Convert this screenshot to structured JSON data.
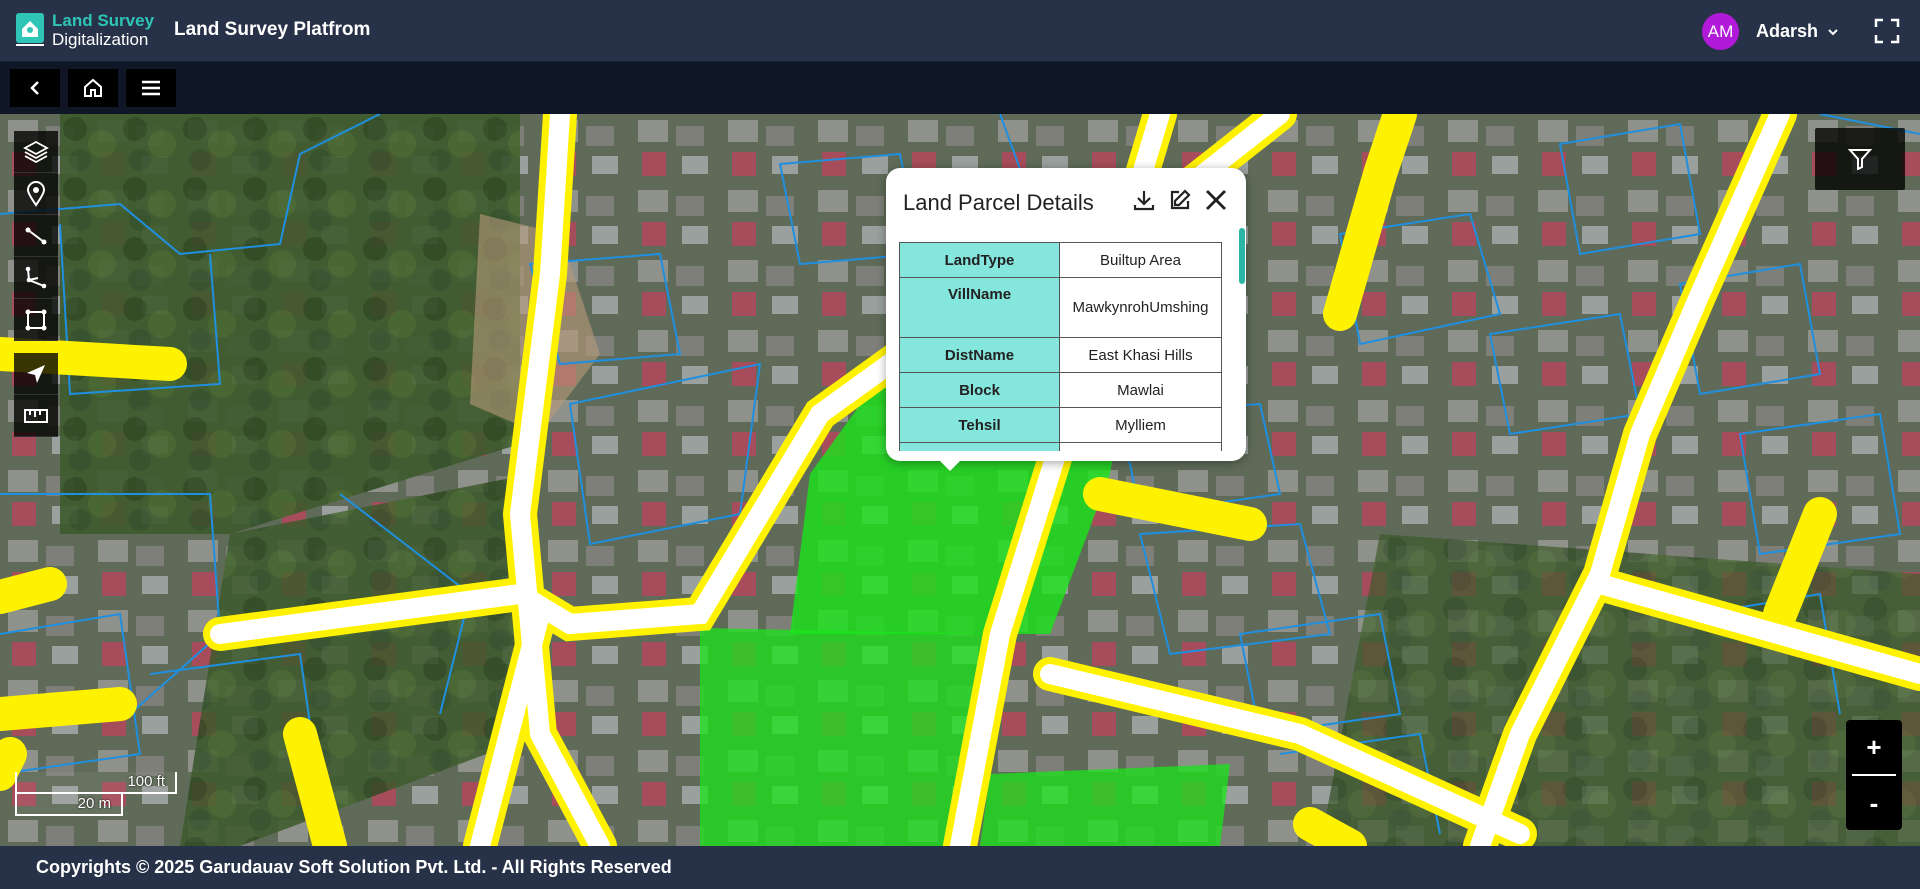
{
  "header": {
    "logo_line1": "Land Survey",
    "logo_line2": "Digitalization",
    "app_title": "Land Survey Platfrom",
    "user": {
      "initials": "AM",
      "name": "Adarsh"
    }
  },
  "toolbar": {
    "icons": [
      "back-icon",
      "home-icon",
      "menu-icon"
    ]
  },
  "map": {
    "left_tools": [
      "layers-icon",
      "marker-icon",
      "line-icon",
      "polyline-icon",
      "polygon-icon",
      "locate-icon",
      "ruler-icon"
    ],
    "filter_icon": "filter-icon",
    "zoom": {
      "in_label": "+",
      "out_label": "-"
    },
    "scale": {
      "imperial": "100 ft",
      "metric": "20 m"
    },
    "colors": {
      "parcel_boundary": "#1f8fe0",
      "road": "#fff200",
      "selected_parcel": "#19e619"
    }
  },
  "popup": {
    "title": "Land Parcel Details",
    "actions": [
      "download-icon",
      "edit-icon",
      "close-icon"
    ],
    "rows": [
      {
        "key": "LandType",
        "value": "Builtup Area"
      },
      {
        "key": "VillName",
        "value": "MawkynrohUmshing"
      },
      {
        "key": "DistName",
        "value": "East Khasi Hills"
      },
      {
        "key": "Block",
        "value": "Mawlai"
      },
      {
        "key": "Tehsil",
        "value": "Mylliem"
      },
      {
        "key": "",
        "value": ""
      }
    ]
  },
  "footer": {
    "copyright": "Copyrights © 2025 Garudauav Soft Solution Pvt. Ltd. - All Rights Reserved"
  }
}
